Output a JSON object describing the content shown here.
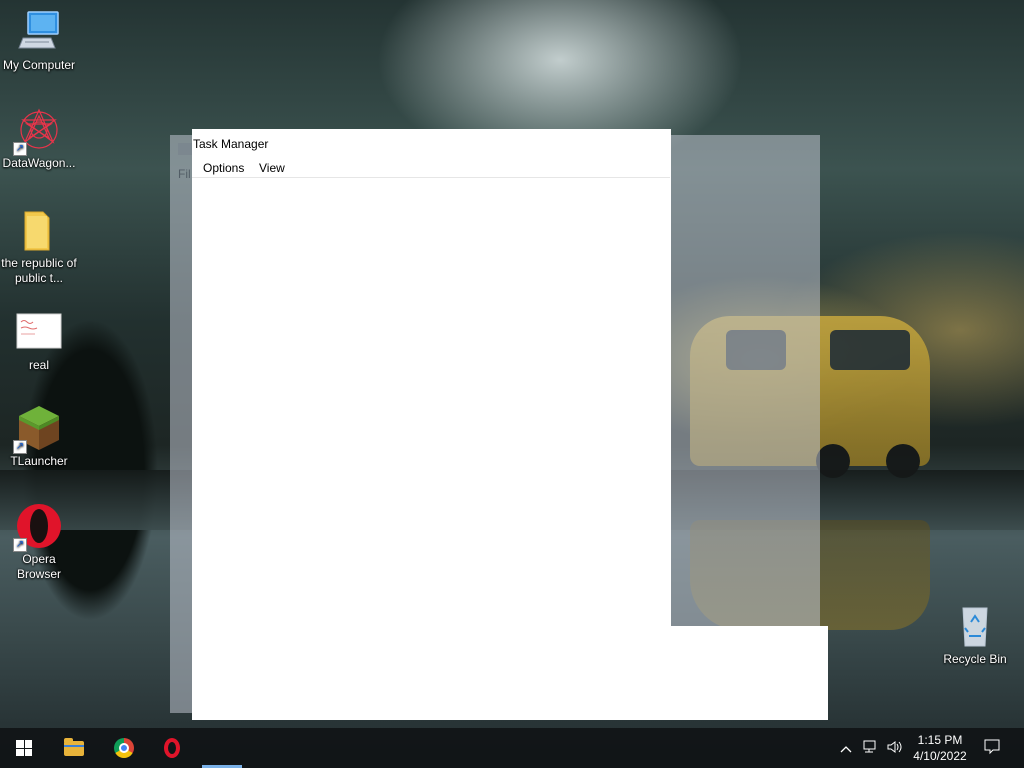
{
  "desktop": {
    "icons": [
      {
        "label": "My Computer",
        "icon": "computer-icon",
        "shortcut": false
      },
      {
        "label": "DataWagon...",
        "icon": "datawagon-icon",
        "shortcut": true
      },
      {
        "label": "the republic of public t...",
        "icon": "folder-icon",
        "shortcut": false
      },
      {
        "label": "real",
        "icon": "image-file-icon",
        "shortcut": false
      },
      {
        "label": "TLauncher",
        "icon": "minecraft-grass-block-icon",
        "shortcut": true
      },
      {
        "label": "Opera Browser",
        "icon": "opera-icon",
        "shortcut": true
      },
      {
        "label": "Recycle Bin",
        "icon": "recycle-bin-icon",
        "shortcut": false
      }
    ]
  },
  "background_window": {
    "menu_partial": "Fil"
  },
  "task_manager": {
    "title": "Task Manager",
    "menu": [
      "Options",
      "View"
    ]
  },
  "taskbar": {
    "buttons": [
      "start-button",
      "file-explorer",
      "chrome",
      "opera"
    ],
    "tray": {
      "icons": [
        "chevron-up-icon",
        "network-icon",
        "volume-icon",
        "notification-icon"
      ],
      "time": "1:15 PM",
      "date": "4/10/2022"
    }
  },
  "colors": {
    "taskbar": "#101416",
    "window_bg": "#ffffff",
    "active_indicator": "#7ab1e8"
  }
}
